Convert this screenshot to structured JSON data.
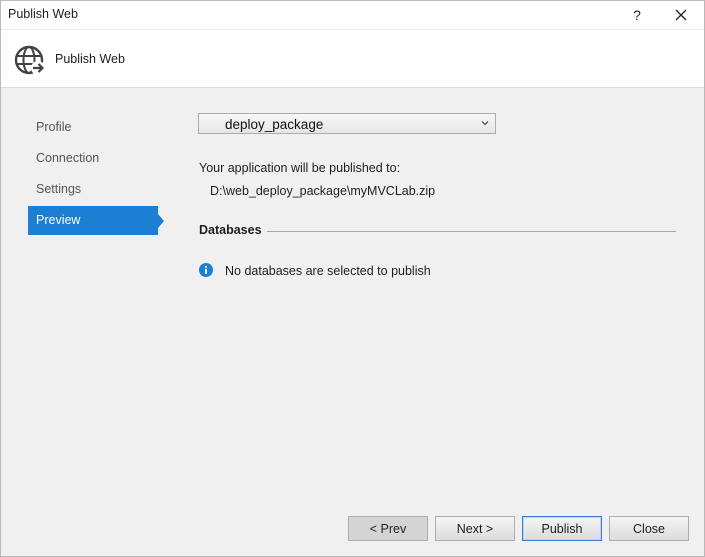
{
  "window": {
    "title": "Publish Web",
    "help_label": "?"
  },
  "header": {
    "title": "Publish Web",
    "icon": "globe-icon"
  },
  "nav": {
    "items": [
      {
        "label": "Profile",
        "active": false
      },
      {
        "label": "Connection",
        "active": false
      },
      {
        "label": "Settings",
        "active": false
      },
      {
        "label": "Preview",
        "active": true
      }
    ]
  },
  "profile": {
    "selected": "deploy_package"
  },
  "publish": {
    "label": "Your application will be published to:",
    "path": "D:\\web_deploy_package\\myMVCLab.zip"
  },
  "databases": {
    "header": "Databases",
    "info_text": "No databases are selected to publish"
  },
  "buttons": {
    "prev": "< Prev",
    "next": "Next >",
    "publish": "Publish",
    "close": "Close"
  },
  "colors": {
    "accent": "#1c7fd1",
    "info": "#1c7fd1",
    "background": "#f0f0f0"
  }
}
